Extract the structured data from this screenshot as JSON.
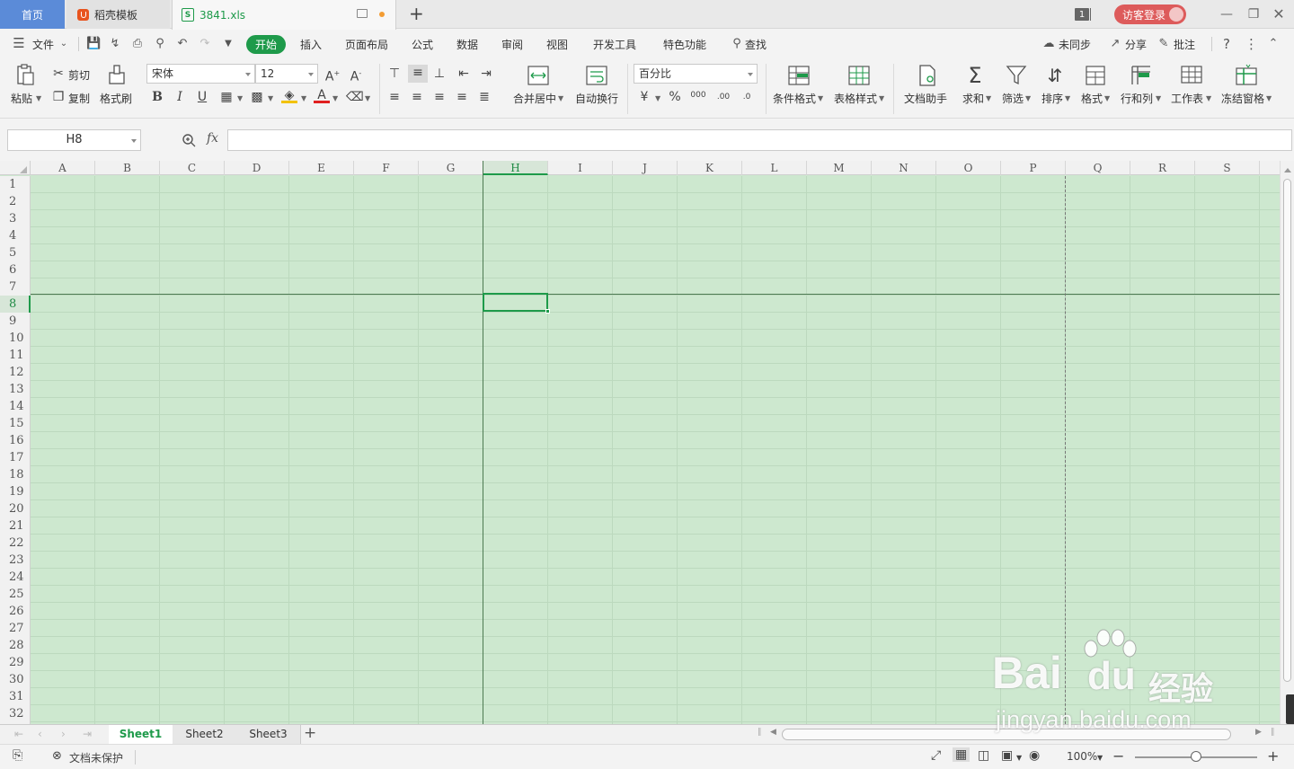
{
  "tabs": {
    "home": "首页",
    "docer": "稻壳模板",
    "file": "3841.xls",
    "file_icon": "S"
  },
  "titlebar": {
    "window_count": "1",
    "login": "访客登录"
  },
  "menu": {
    "file": "文件",
    "items": [
      "开始",
      "插入",
      "页面布局",
      "公式",
      "数据",
      "审阅",
      "视图",
      "开发工具",
      "特色功能"
    ],
    "search": "查找",
    "sync": "未同步",
    "share": "分享",
    "comment": "批注"
  },
  "ribbon": {
    "paste": "粘贴",
    "cut": "剪切",
    "copy": "复制",
    "format_painter": "格式刷",
    "font_name": "宋体",
    "font_size": "12",
    "merge_center": "合并居中",
    "auto_wrap": "自动换行",
    "number_format": "百分比",
    "conditional_format": "条件格式",
    "table_style": "表格样式",
    "doc_assistant": "文档助手",
    "sum": "求和",
    "filter": "筛选",
    "sort": "排序",
    "format": "格式",
    "row_col": "行和列",
    "worksheet": "工作表",
    "freeze": "冻结窗格"
  },
  "formula_bar": {
    "name_box": "H8",
    "fx": "fx",
    "value": ""
  },
  "grid": {
    "columns": [
      "A",
      "B",
      "C",
      "D",
      "E",
      "F",
      "G",
      "H",
      "I",
      "J",
      "K",
      "L",
      "M",
      "N",
      "O",
      "P",
      "Q",
      "R",
      "S"
    ],
    "rows": [
      "1",
      "2",
      "3",
      "4",
      "5",
      "6",
      "7",
      "8",
      "9",
      "10",
      "11",
      "12",
      "13",
      "14",
      "15",
      "16",
      "17",
      "18",
      "19",
      "20",
      "21",
      "22",
      "23",
      "24",
      "25",
      "26",
      "27",
      "28",
      "29",
      "30",
      "31",
      "32"
    ],
    "active_column": "H",
    "active_row": "8",
    "fill_color": "#cde8cf"
  },
  "sheets": {
    "tabs": [
      "Sheet1",
      "Sheet2",
      "Sheet3"
    ],
    "active": "Sheet1",
    "add": "+"
  },
  "status": {
    "protect": "文档未保护",
    "zoom": "100%"
  },
  "watermark": {
    "brand": "Bai",
    "brand2": "du",
    "cn": "经验",
    "url": "jingyan.baidu.com"
  },
  "colors": {
    "accent": "#1e9a4a",
    "home_tab": "#5b8bd8",
    "login": "#dd5b5b"
  }
}
